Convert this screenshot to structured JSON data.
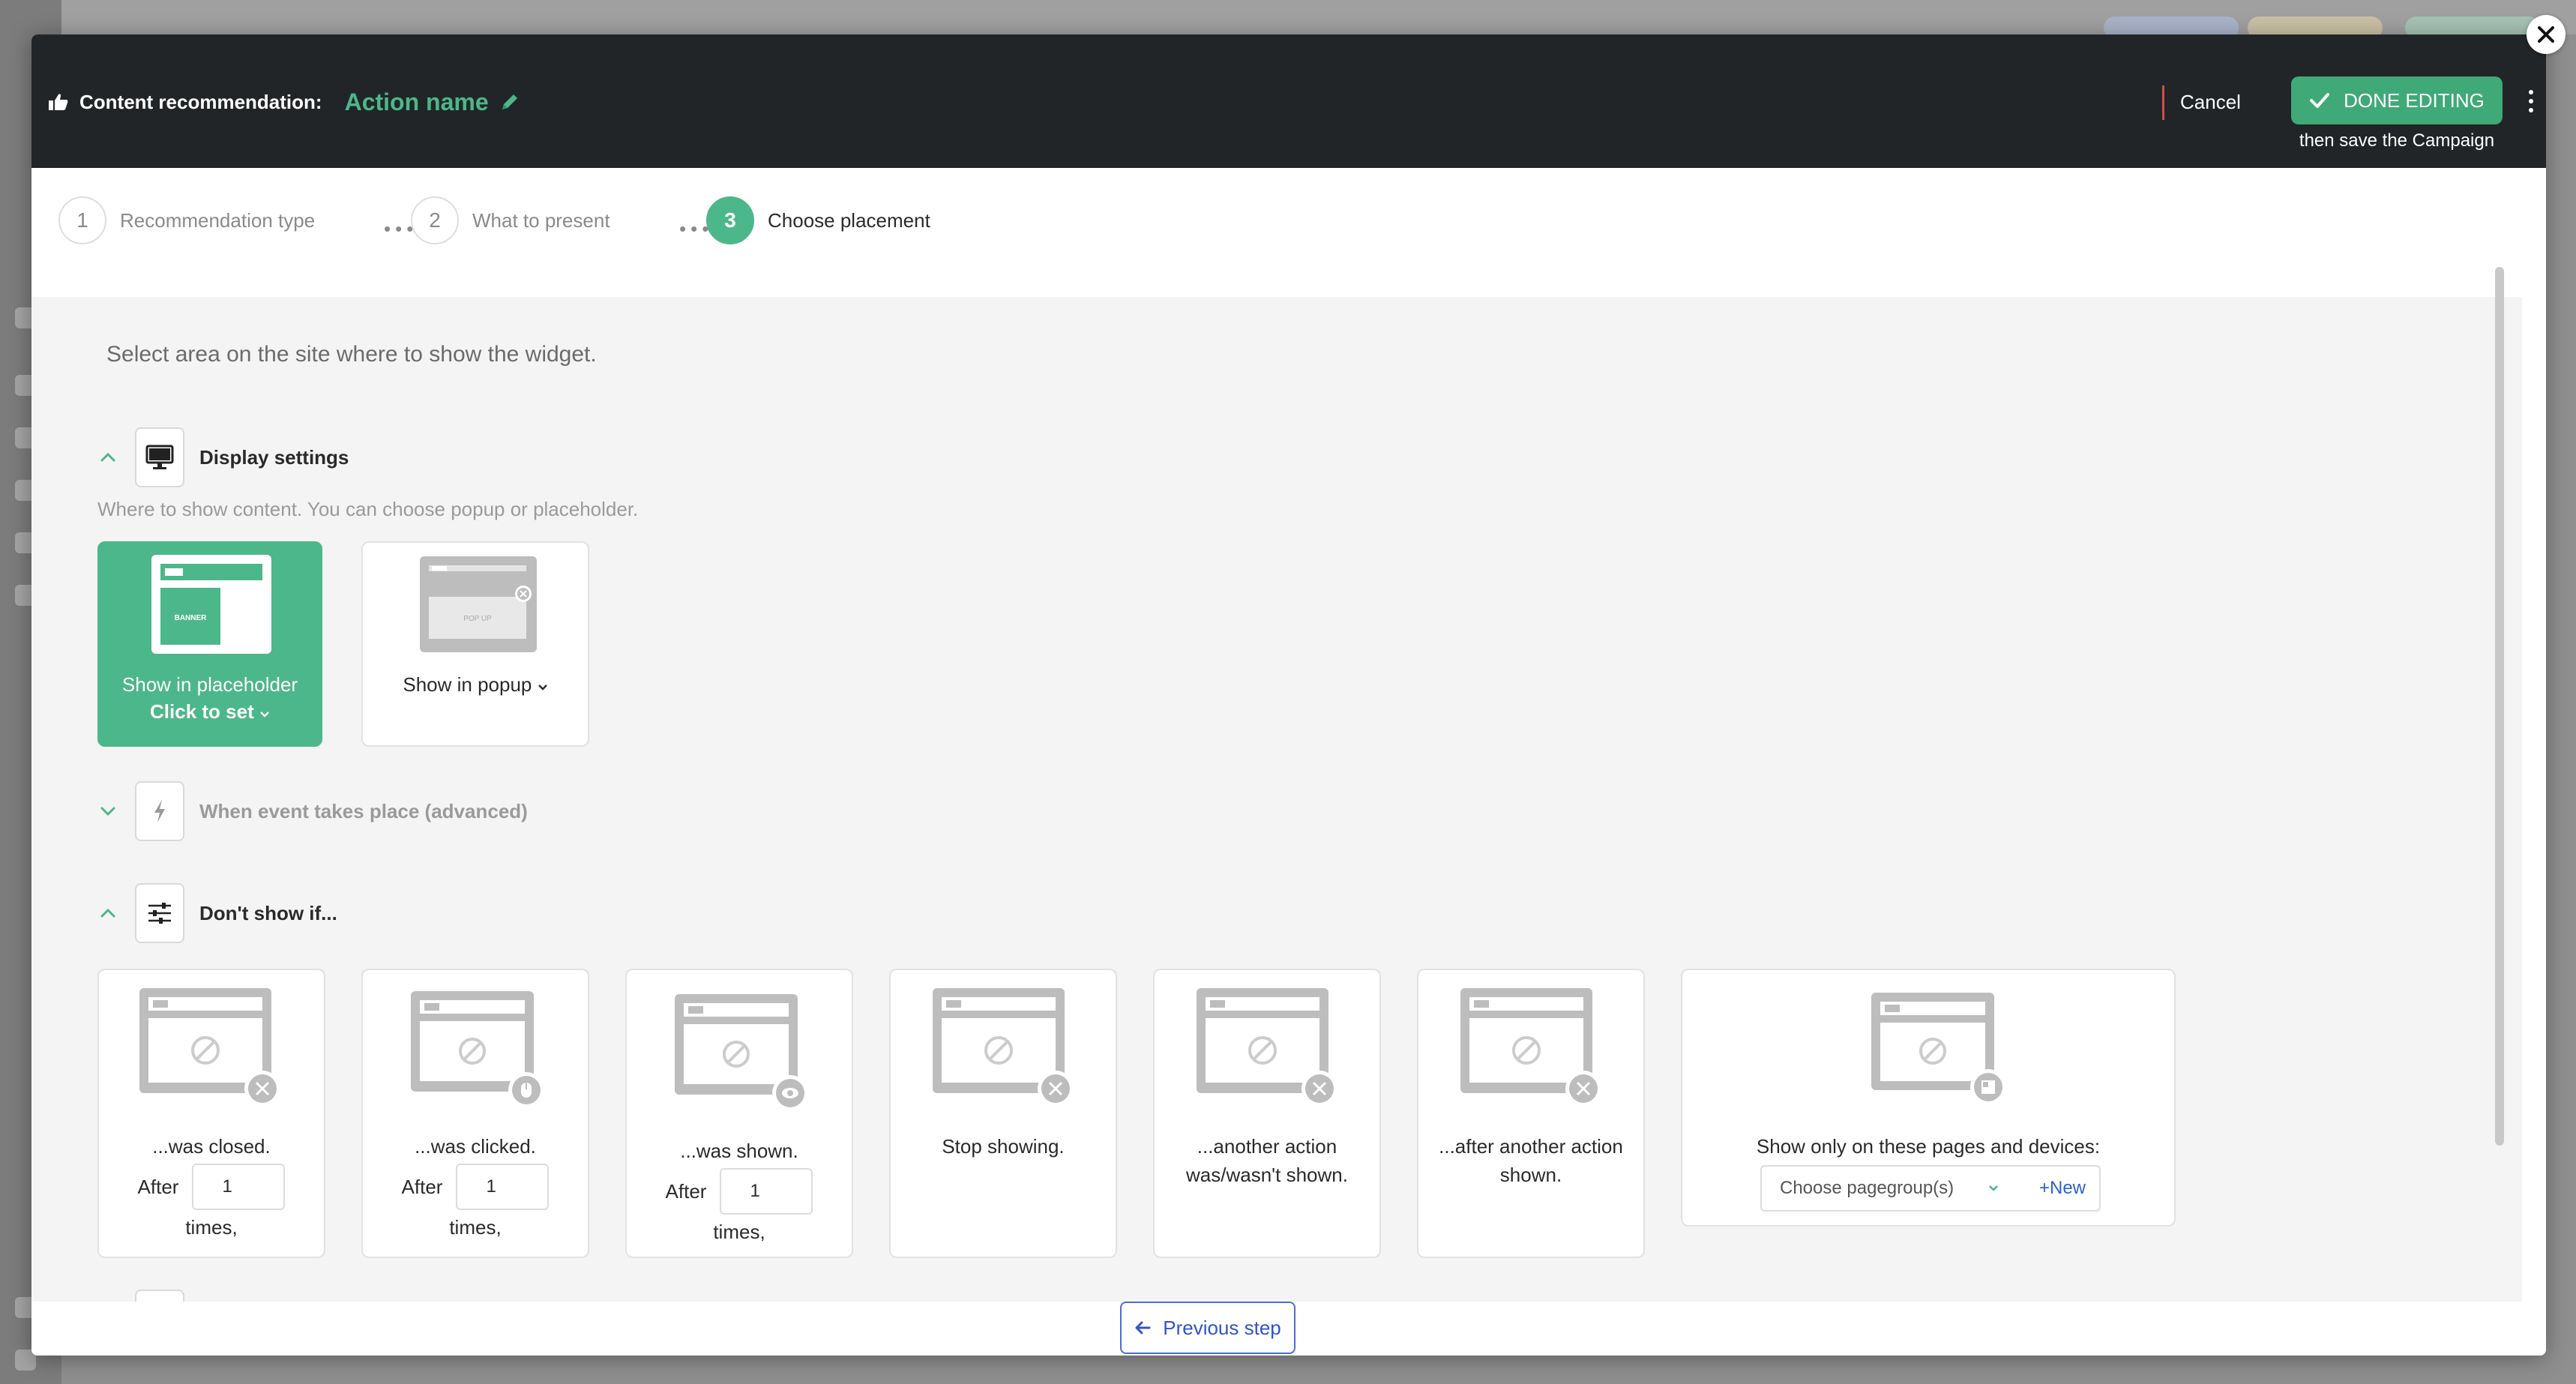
{
  "header": {
    "label": "Content recommendation:",
    "action_name": "Action name",
    "cancel": "Cancel",
    "done": "DONE EDITING",
    "done_sub": "then save the Campaign"
  },
  "steps": [
    {
      "number": "1",
      "label": "Recommendation type"
    },
    {
      "number": "2",
      "label": "What to present"
    },
    {
      "number": "3",
      "label": "Choose placement"
    }
  ],
  "intro": "Select area on the site where to show the widget.",
  "display_settings": {
    "title": "Display settings",
    "description": "Where to show content. You can choose popup or placeholder.",
    "placeholder_card": {
      "label": "Show in placeholder",
      "sub": "Click to set",
      "thumb": "BANNER"
    },
    "popup_card": {
      "label": "Show in popup",
      "thumb": "POP UP"
    }
  },
  "event_section": {
    "title": "When event takes place (advanced)"
  },
  "dont_show": {
    "title": "Don't show if...",
    "cards": [
      {
        "label": "...was closed.",
        "after": "After",
        "value": "1",
        "times": "times,"
      },
      {
        "label": "...was clicked.",
        "after": "After",
        "value": "1",
        "times": "times,"
      },
      {
        "label": "...was shown.",
        "after": "After",
        "value": "1",
        "times": "times,"
      },
      {
        "label": "Stop showing."
      },
      {
        "label1": "...another action",
        "label2": "was/wasn't shown."
      },
      {
        "label1": "...after another action",
        "label2": "shown."
      }
    ],
    "pages_card": {
      "label": "Show only on these pages and devices:",
      "select": "Choose pagegroup(s)",
      "new": "+New"
    }
  },
  "footer": {
    "previous": "Previous step"
  },
  "colors": {
    "accent": "#4cb78a",
    "header_bg": "#222527",
    "link": "#2f55c7"
  }
}
